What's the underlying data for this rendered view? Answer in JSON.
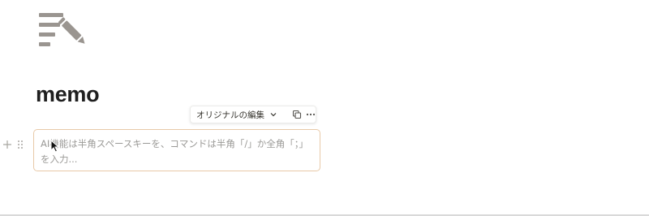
{
  "page": {
    "title": "memo",
    "icon": "edit-note-icon"
  },
  "block_toolbar": {
    "label": "オリジナルの編集",
    "chevron_icon": "chevron-down-icon",
    "copy_icon": "copy-icon",
    "more_icon": "more-horizontal-icon"
  },
  "editor": {
    "add_icon": "plus-icon",
    "drag_icon": "drag-handle-icon",
    "ai_input": {
      "placeholder": "AI機能は半角スペースキーを、コマンドは半角「/」か全角「；」を入力..."
    }
  },
  "colors": {
    "icon": "#9a9590",
    "title": "#1f1f1f",
    "input_border": "#e8c9a8",
    "placeholder": "#9b9a97"
  }
}
